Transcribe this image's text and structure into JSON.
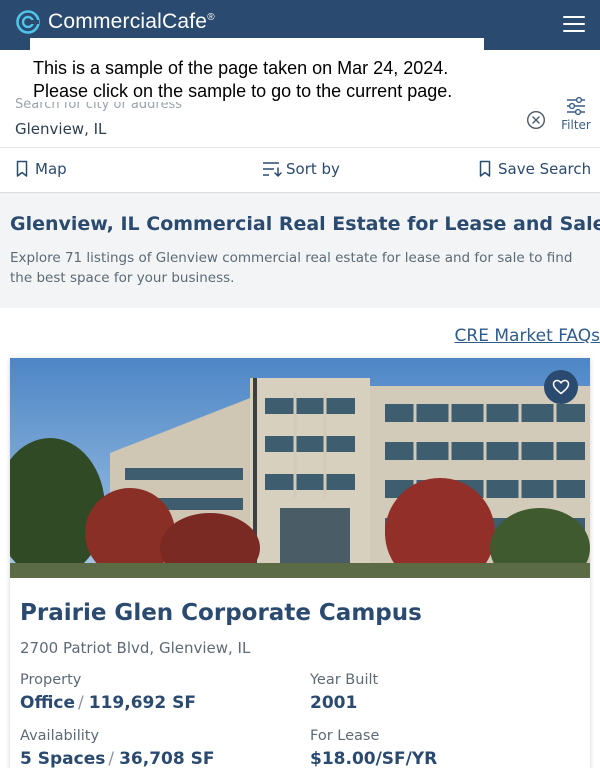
{
  "header": {
    "brand": "CommercialCafe",
    "brand_mark": "®",
    "logo_icon": "commercialcafe-logo-icon",
    "menu_icon": "hamburger-menu-icon",
    "colors": {
      "navbar": "#2b4a6f",
      "text": "#ffffff"
    }
  },
  "notice": {
    "line1": "This is a sample of the page taken on Mar 24, 2024.",
    "line2": "Please click on the sample to go to the current page."
  },
  "search": {
    "placeholder": "Search for city or address",
    "value": "Glenview, IL",
    "clear_icon": "clear-circle-x-icon",
    "filter_label": "Filter",
    "filter_icon": "sliders-filter-icon"
  },
  "toolbar": {
    "map_label": "Map",
    "map_icon": "bookmark-icon",
    "sort_label": "Sort by",
    "sort_icon": "sort-lines-icon",
    "save_label": "Save Search",
    "save_icon": "bookmark-icon"
  },
  "intro": {
    "title": "Glenview, IL Commercial Real Estate for Lease and Sale",
    "description": "Explore 71 listings of Glenview commercial real estate for lease and for sale to find the best space for your business."
  },
  "faq_link": "CRE Market FAQs",
  "listing": {
    "title": "Prairie Glen Corporate Campus",
    "address": "2700 Patriot Blvd, Glenview, IL",
    "favorite_icon": "heart-icon",
    "property_label": "Property",
    "property_type": "Office",
    "property_size": "119,692 SF",
    "year_built_label": "Year Built",
    "year_built": "2001",
    "availability_label": "Availability",
    "availability_spaces": "5 Spaces",
    "availability_size": "36,708 SF",
    "lease_label": "For Lease",
    "lease_rate": "$18.00/SF/YR",
    "separator": "/"
  }
}
